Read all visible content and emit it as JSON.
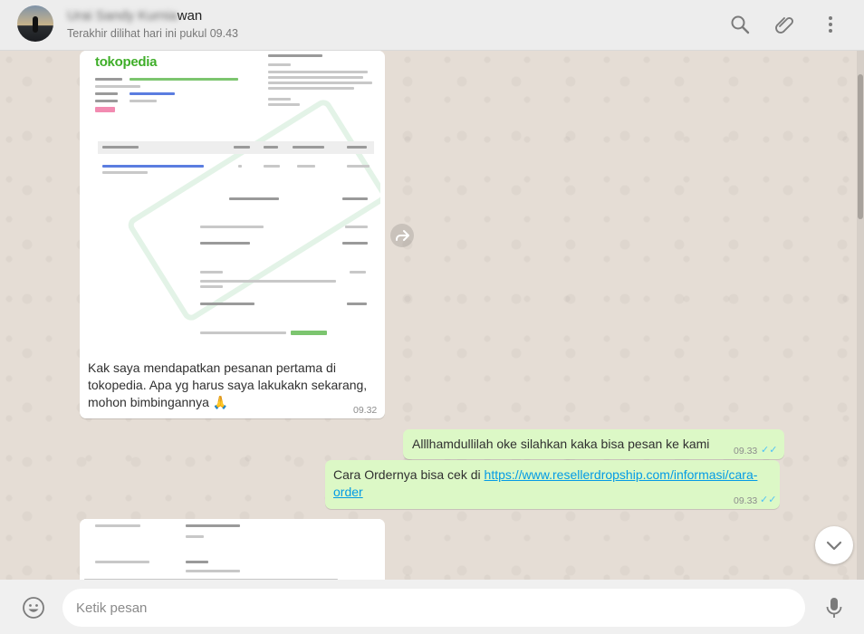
{
  "header": {
    "contact_name_visible": "wan",
    "contact_name_redacted": "Urai Sandy Kurnia",
    "last_seen": "Terakhir dilihat hari ini pukul 09.43",
    "icons": [
      "search-icon",
      "attach-icon",
      "menu-icon"
    ]
  },
  "messages": [
    {
      "direction": "incoming",
      "type": "image",
      "image_logo": "tokopedia",
      "text": "Kak saya mendapatkan pesanan pertama di tokopedia. Apa yg harus saya lakukakn sekarang, mohon bimbingannya 🙏",
      "time": "09.32"
    },
    {
      "direction": "outgoing",
      "text": "Alllhamdullilah oke silahkan kaka bisa pesan ke kami",
      "time": "09.33",
      "status": "read"
    },
    {
      "direction": "outgoing",
      "text_prefix": "Cara Ordernya bisa cek di ",
      "link": "https://www.resellerdropship.com/informasi/cara-order",
      "link_line1": "https://www.resellerdropship.com/informasi/cara-",
      "link_line2": "order",
      "time": "09.33",
      "status": "read"
    },
    {
      "direction": "incoming",
      "type": "image",
      "partial": true
    }
  ],
  "composer": {
    "placeholder": "Ketik pesan",
    "icons": [
      "emoji-icon",
      "mic-icon"
    ]
  },
  "colors": {
    "chat_bg": "#e5ddd5",
    "outgoing_bubble": "#dcf8c6",
    "incoming_bubble": "#ffffff",
    "link": "#039be5",
    "read_ticks": "#4fc3f7",
    "tokopedia_green": "#3fae29"
  }
}
